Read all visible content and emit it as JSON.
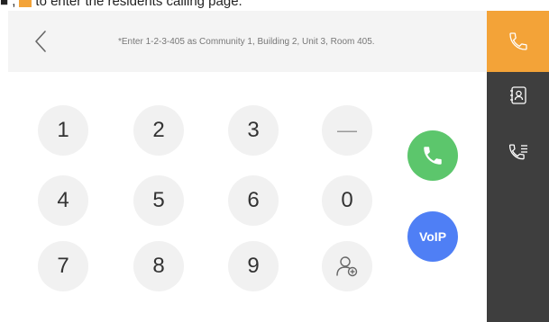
{
  "caption": {
    "glyphs": "■ ,  ",
    "text": "to enter the residents calling page."
  },
  "header": {
    "hint": "*Enter 1-2-3-405 as Community 1, Building 2, Unit 3, Room 405."
  },
  "keypad": {
    "keys": [
      "1",
      "2",
      "3",
      "—",
      "4",
      "5",
      "6",
      "0",
      "7",
      "8",
      "9"
    ]
  },
  "actions": {
    "voip_label": "VoIP"
  },
  "icons": {
    "back": "chevron-left-icon",
    "call": "phone-icon",
    "contacts": "contact-book-icon",
    "records": "call-log-icon",
    "add_contact": "add-user-icon"
  },
  "colors": {
    "accent": "#f3a338",
    "sidebar": "#3e3e3e",
    "header": "#f4f4f4",
    "key": "#f1f1f1",
    "call": "#5cc66c",
    "voip": "#4f7ff5"
  }
}
